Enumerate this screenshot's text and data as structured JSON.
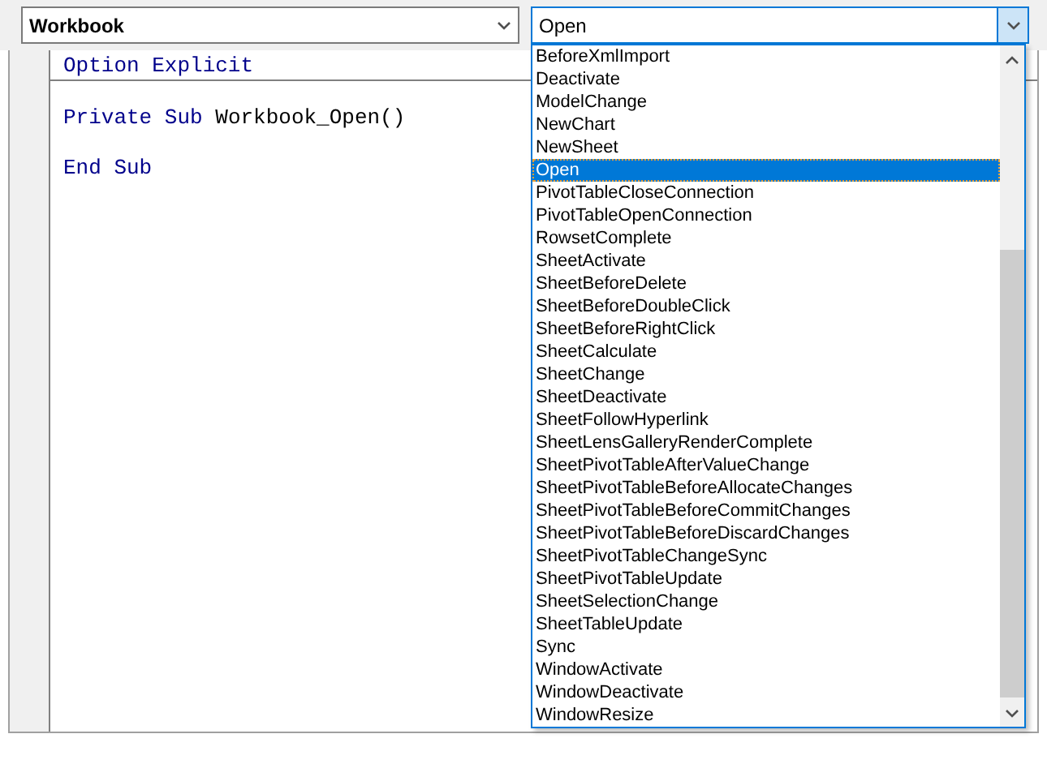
{
  "object_combo": {
    "value": "Workbook"
  },
  "procedure_combo": {
    "value": "Open",
    "expanded": true
  },
  "code_lines": [
    {
      "tokens": [
        {
          "kind": "keyword",
          "text": "Option Explicit"
        }
      ],
      "divider": true
    },
    {
      "tokens": [
        {
          "kind": "keyword",
          "text": "Private Sub"
        },
        {
          "kind": "plain",
          "text": "Workbook_Open()"
        }
      ]
    },
    {
      "tokens": [
        {
          "kind": "keyword",
          "text": "End Sub"
        }
      ]
    }
  ],
  "procedure_list": [
    {
      "label": "BeforeXmlImport",
      "selected": false
    },
    {
      "label": "Deactivate",
      "selected": false
    },
    {
      "label": "ModelChange",
      "selected": false
    },
    {
      "label": "NewChart",
      "selected": false
    },
    {
      "label": "NewSheet",
      "selected": false
    },
    {
      "label": "Open",
      "selected": true
    },
    {
      "label": "PivotTableCloseConnection",
      "selected": false
    },
    {
      "label": "PivotTableOpenConnection",
      "selected": false
    },
    {
      "label": "RowsetComplete",
      "selected": false
    },
    {
      "label": "SheetActivate",
      "selected": false
    },
    {
      "label": "SheetBeforeDelete",
      "selected": false
    },
    {
      "label": "SheetBeforeDoubleClick",
      "selected": false
    },
    {
      "label": "SheetBeforeRightClick",
      "selected": false
    },
    {
      "label": "SheetCalculate",
      "selected": false
    },
    {
      "label": "SheetChange",
      "selected": false
    },
    {
      "label": "SheetDeactivate",
      "selected": false
    },
    {
      "label": "SheetFollowHyperlink",
      "selected": false
    },
    {
      "label": "SheetLensGalleryRenderComplete",
      "selected": false
    },
    {
      "label": "SheetPivotTableAfterValueChange",
      "selected": false
    },
    {
      "label": "SheetPivotTableBeforeAllocateChanges",
      "selected": false
    },
    {
      "label": "SheetPivotTableBeforeCommitChanges",
      "selected": false
    },
    {
      "label": "SheetPivotTableBeforeDiscardChanges",
      "selected": false
    },
    {
      "label": "SheetPivotTableChangeSync",
      "selected": false
    },
    {
      "label": "SheetPivotTableUpdate",
      "selected": false
    },
    {
      "label": "SheetSelectionChange",
      "selected": false
    },
    {
      "label": "SheetTableUpdate",
      "selected": false
    },
    {
      "label": "Sync",
      "selected": false
    },
    {
      "label": "WindowActivate",
      "selected": false
    },
    {
      "label": "WindowDeactivate",
      "selected": false
    },
    {
      "label": "WindowResize",
      "selected": false
    }
  ]
}
